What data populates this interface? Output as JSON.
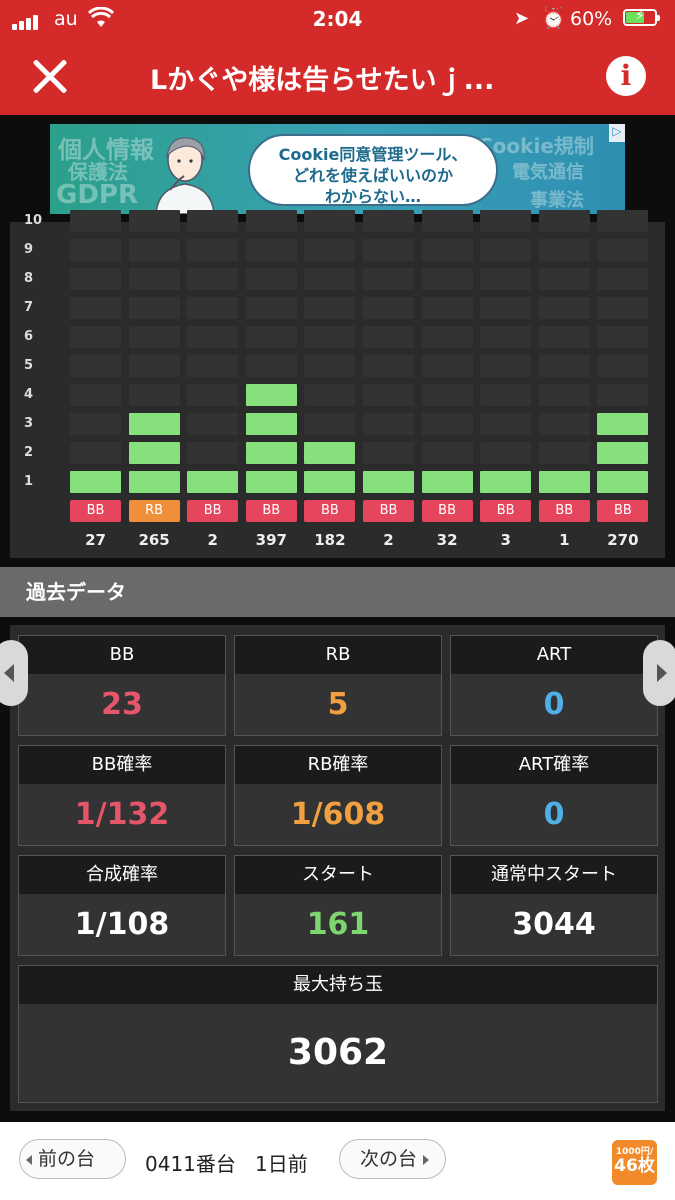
{
  "status_bar": {
    "carrier": "au",
    "time": "2:04",
    "battery": "60%"
  },
  "header": {
    "title": "Lかぐや様は告らせたいｊ..."
  },
  "ad": {
    "bubble_line1": "Cookie同意管理ツール、",
    "bubble_line2": "どれを使えばいいのか",
    "bubble_line3": "わからない…",
    "bg_words": [
      "個人情報",
      "保護法",
      "GDPR",
      "Cookie規制",
      "電気通信",
      "事業法"
    ]
  },
  "chart_data": {
    "type": "bar",
    "y_ticks": [
      "1",
      "2",
      "3",
      "4",
      "5",
      "6",
      "7",
      "8",
      "9",
      "10"
    ],
    "ylim": [
      0,
      10
    ],
    "values": [
      1,
      3,
      1,
      4,
      2,
      1,
      1,
      1,
      1,
      3
    ],
    "bonus_types": [
      "BB",
      "RB",
      "BB",
      "BB",
      "BB",
      "BB",
      "BB",
      "BB",
      "BB",
      "BB"
    ],
    "games": [
      "27",
      "265",
      "2",
      "397",
      "182",
      "2",
      "32",
      "3",
      "1",
      "270"
    ],
    "colors": {
      "bar_on": "#86e07c",
      "bar_off": "#333333",
      "bb": "#e5465d",
      "rb": "#ef8f3a"
    }
  },
  "section": {
    "title": "過去データ"
  },
  "stats": {
    "bb": {
      "label": "BB",
      "value": "23"
    },
    "rb": {
      "label": "RB",
      "value": "5"
    },
    "art": {
      "label": "ART",
      "value": "0"
    },
    "bb_prob": {
      "label": "BB確率",
      "value": "1/132"
    },
    "rb_prob": {
      "label": "RB確率",
      "value": "1/608"
    },
    "art_prob": {
      "label": "ART確率",
      "value": "0"
    },
    "combined": {
      "label": "合成確率",
      "value": "1/108"
    },
    "start": {
      "label": "スタート",
      "value": "161"
    },
    "normal_start": {
      "label": "通常中スタート",
      "value": "3044"
    },
    "max_balls": {
      "label": "最大持ち玉",
      "value": "3062"
    }
  },
  "stat_colors": {
    "red": "#e5566a",
    "orange": "#f0a040",
    "blue": "#4fb0e8",
    "green": "#7ed66e",
    "white": "#ffffff"
  },
  "footer": {
    "prev": "前の台",
    "machine": "0411番台",
    "day": "1日前",
    "next": "次の台",
    "coin_top": "1000円/",
    "coin_bottom": "46枚"
  }
}
